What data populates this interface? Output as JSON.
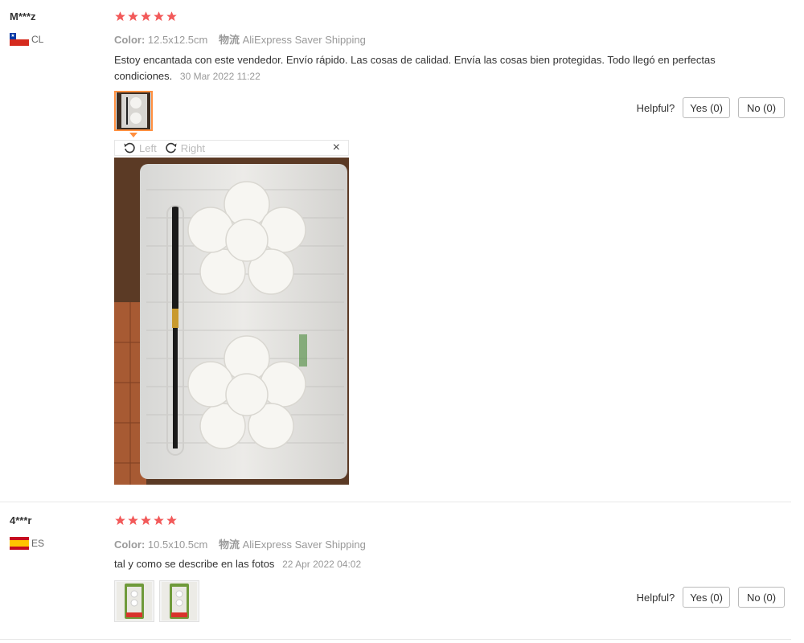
{
  "reviews": [
    {
      "user": "M***z",
      "country": "CL",
      "rating": 5,
      "color_label": "Color:",
      "color_value": "12.5x12.5cm",
      "shipping_label": "物流",
      "shipping_value": "AliExpress Saver Shipping",
      "text": "Estoy encantada con este vendedor. Envío rápido. Las cosas de calidad. Envía las cosas bien protegidas. Todo llegó en perfectas condiciones.",
      "date": "30 Mar 2022 11:22",
      "helpful_label": "Helpful?",
      "yes_label": "Yes (0)",
      "no_label": "No (0)",
      "viewer": {
        "rotate_left": "Left",
        "rotate_right": "Right",
        "close": "×"
      }
    },
    {
      "user": "4***r",
      "country": "ES",
      "rating": 5,
      "color_label": "Color:",
      "color_value": "10.5x10.5cm",
      "shipping_label": "物流",
      "shipping_value": "AliExpress Saver Shipping",
      "text": "tal y como se describe en las fotos",
      "date": "22 Apr 2022 04:02",
      "helpful_label": "Helpful?",
      "yes_label": "Yes (0)",
      "no_label": "No (0)"
    }
  ],
  "colors": {
    "star": "#f25a5a",
    "active_thumb_border": "#ff8f3f",
    "muted_text": "#999999"
  }
}
